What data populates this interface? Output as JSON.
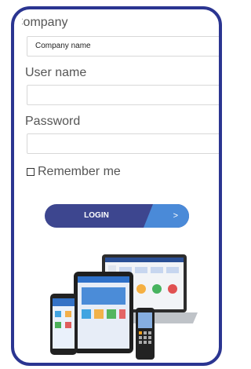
{
  "form": {
    "company_label": "Company",
    "company_value": "Company name",
    "username_label": "User name",
    "username_value": "",
    "password_label": "Password",
    "password_value": "",
    "remember_label": "Remember me",
    "remember_checked": false
  },
  "login_button": {
    "label": "LOGIN",
    "arrow": ">"
  },
  "colors": {
    "frame": "#2b3591",
    "button_primary": "#3d468f",
    "button_accent": "#4a8ad8"
  },
  "illustration": {
    "icon": "devices-illustration"
  }
}
